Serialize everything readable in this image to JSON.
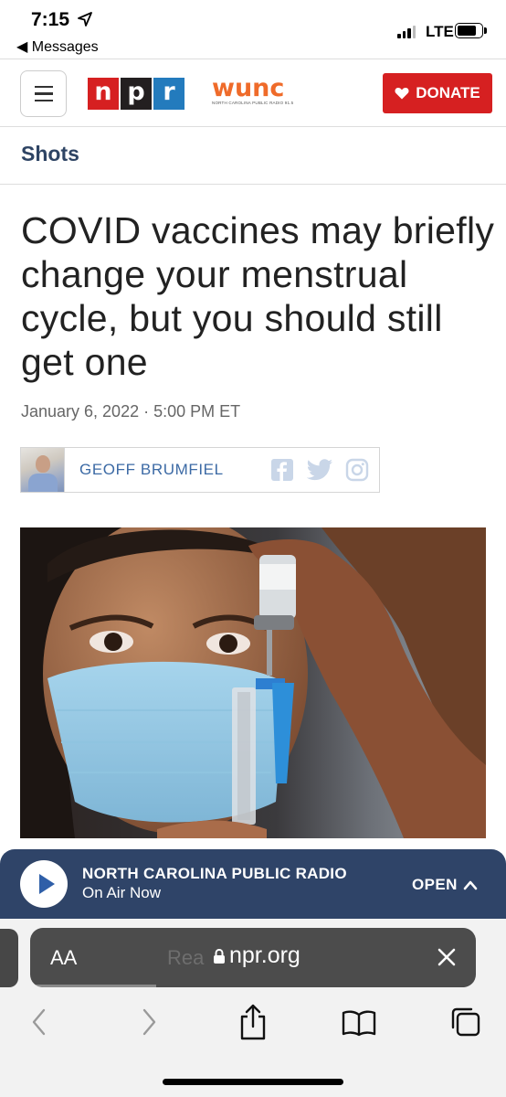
{
  "status_bar": {
    "time": "7:15",
    "back_app": "◀ Messages",
    "network": "LTE"
  },
  "header": {
    "npr_letters": [
      "n",
      "p",
      "r"
    ],
    "npr_colors": [
      "#d62021",
      "#231f20",
      "#237bbd"
    ],
    "station_logo": "WUNC",
    "station_tagline": "NORTH CAROLINA PUBLIC RADIO 91.5",
    "donate_label": "DONATE"
  },
  "article": {
    "section": "Shots",
    "headline": "COVID vaccines may briefly change your menstrual cycle, but you should still get one",
    "date": "January 6, 2022 · 5:00 PM ET",
    "author": "GEOFF BRUMFIEL"
  },
  "player": {
    "station": "NORTH CAROLINA PUBLIC RADIO",
    "status": "On Air Now",
    "open_label": "OPEN"
  },
  "browser": {
    "text_size_label": "AA",
    "behind_text": "Rea         fable",
    "url": "npr.org"
  },
  "colors": {
    "npr_navy": "#2f4468",
    "donate_red": "#d62021",
    "author_blue": "#3c6aa5"
  }
}
